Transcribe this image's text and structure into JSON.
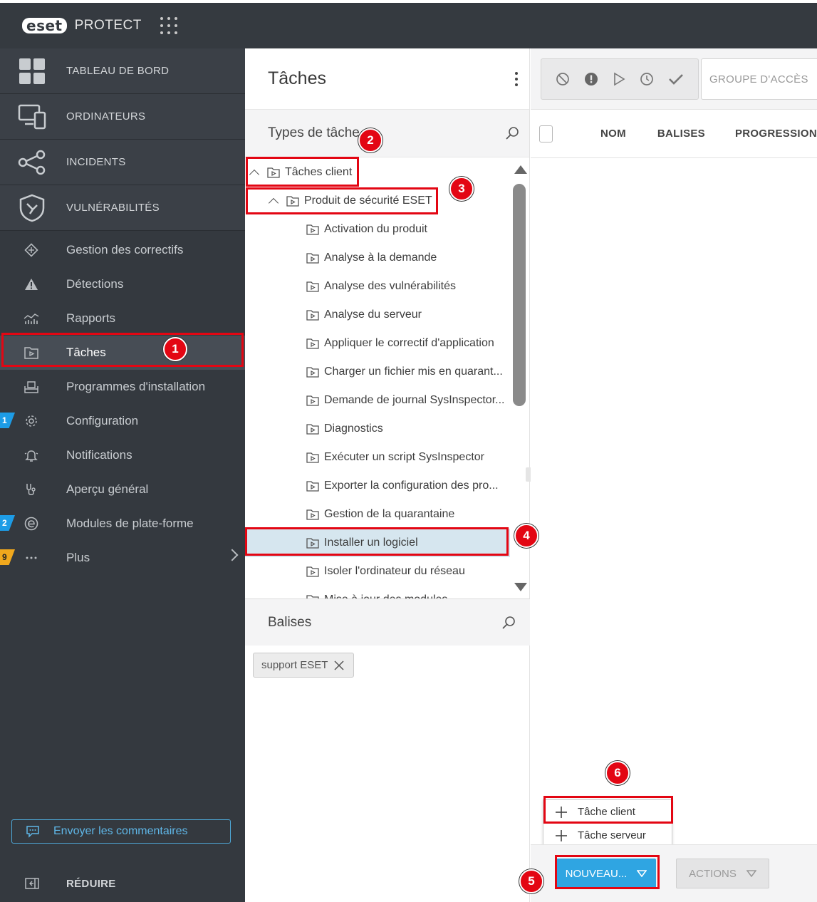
{
  "header": {
    "logo_badge": "eset",
    "product": "PROTECT"
  },
  "sidebar": {
    "main_items": [
      {
        "label": "TABLEAU DE BORD",
        "icon": "dashboard-icon"
      },
      {
        "label": "ORDINATEURS",
        "icon": "computers-icon"
      },
      {
        "label": "INCIDENTS",
        "icon": "incidents-icon"
      },
      {
        "label": "VULNÉRABILITÉS",
        "icon": "shield-icon"
      }
    ],
    "items": [
      {
        "label": "Gestion des correctifs",
        "icon": "patch-icon"
      },
      {
        "label": "Détections",
        "icon": "warning-icon"
      },
      {
        "label": "Rapports",
        "icon": "reports-icon"
      },
      {
        "label": "Tâches",
        "icon": "tasks-icon"
      },
      {
        "label": "Programmes d'installation",
        "icon": "installer-icon"
      },
      {
        "label": "Configuration",
        "icon": "gear-icon",
        "badge": "1"
      },
      {
        "label": "Notifications",
        "icon": "bell-icon"
      },
      {
        "label": "Aperçu général",
        "icon": "stethoscope-icon"
      },
      {
        "label": "Modules de plate-forme",
        "icon": "modules-icon",
        "badge": "2"
      },
      {
        "label": "Plus",
        "icon": "more-icon",
        "badge": "9"
      }
    ],
    "feedback": "Envoyer les commentaires",
    "collapse": "RÉDUIRE"
  },
  "middle": {
    "title": "Tâches",
    "types_title": "Types de tâche",
    "tree": {
      "client": "Tâches client",
      "security_product": "Produit de sécurité ESET",
      "items": [
        "Activation du produit",
        "Analyse à la demande",
        "Analyse des vulnérabilités",
        "Analyse du serveur",
        "Appliquer le correctif d'application",
        "Charger un fichier mis en quarant...",
        "Demande de journal SysInspector...",
        "Diagnostics",
        "Exécuter un script SysInspector",
        "Exporter la configuration des pro...",
        "Gestion de la quarantaine",
        "Installer un logiciel",
        "Isoler l'ordinateur du réseau",
        "Mise à jour des modules"
      ]
    },
    "tags_title": "Balises",
    "tag_chip": "support ESET"
  },
  "right": {
    "access_group": "GROUPE D'ACCÈS",
    "columns": [
      "NOM",
      "BALISES",
      "PROGRESSION"
    ],
    "new_button": "NOUVEAU...",
    "actions_button": "ACTIONS",
    "dropdown": [
      "Tâche client",
      "Tâche serveur"
    ]
  },
  "annotations": [
    "1",
    "2",
    "3",
    "4",
    "5",
    "6"
  ],
  "colors": {
    "accent": "#2fa5e2",
    "highlight": "#e30613",
    "sidebar": "#34393f",
    "header": "#353a40"
  }
}
